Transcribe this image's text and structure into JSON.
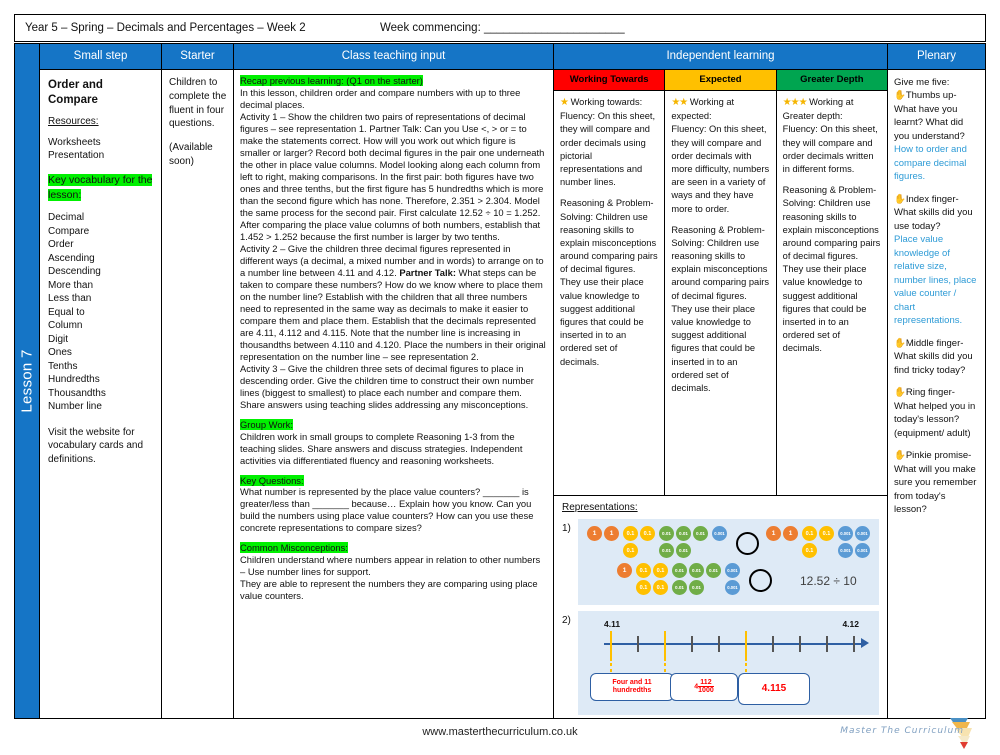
{
  "header": {
    "title": "Year 5 – Spring – Decimals and Percentages – Week 2",
    "week_commencing": "Week commencing: ______________________"
  },
  "spine": {
    "lesson_label": "Lesson 7"
  },
  "columns": {
    "small_step": "Small step",
    "starter": "Starter",
    "class_teaching_input": "Class teaching input",
    "independent_learning": "Independent learning",
    "plenary": "Plenary"
  },
  "small_step": {
    "title": "Order and Compare",
    "resources_heading": "Resources:",
    "resources": [
      "Worksheets",
      "Presentation"
    ],
    "key_vocab_heading": "Key vocabulary for the lesson:",
    "vocabulary": [
      "Decimal",
      "Compare",
      "Order",
      "Ascending",
      "Descending",
      "More than",
      "Less than",
      "Equal to",
      "Column",
      "Digit",
      "Ones",
      "Tenths",
      "Hundredths",
      "Thousandths",
      "Number line"
    ],
    "note": "Visit the website for vocabulary cards and definitions."
  },
  "starter": {
    "text": "Children to complete the fluent in four questions.",
    "availability": "(Available soon)"
  },
  "teaching": {
    "recap_heading": "Recap previous learning: (Q1 on the starter)",
    "intro": "In this lesson, children order and compare numbers with up to three decimal places.",
    "activity1": "Activity 1 – Show the children two pairs of representations of decimal figures – see representation 1. Partner Talk: Can you Use <, > or = to make the statements correct. How will you work out which figure is smaller or larger? Record both decimal figures in the pair one underneath the other in place value columns. Model looking along each column from left to right, making comparisons. In the first pair: both figures have two ones and three tenths, but the first figure has 5 hundredths which is more than the second figure which has none. Therefore, 2.351 > 2.304. Model the same process for the second pair. First calculate 12.52 ÷ 10 = 1.252. After comparing the place value columns of both numbers, establish that 1.452 > 1.252 because the first number is larger by two tenths.",
    "activity2_pre": "Activity 2 – Give the children three decimal figures represented in different ways (a decimal, a mixed number and in words) to arrange on to a number line between 4.11 and 4.12. ",
    "activity2_bold": "Partner Talk:",
    "activity2_post": " What steps can be taken to compare these numbers? How do we know where to place them on the number line? Establish with the children that all three numbers need to represented in the same way as decimals to make it easier to compare them and place them. Establish that the decimals represented are 4.11, 4.112 and 4.115. Note that the number line is increasing in thousandths between 4.110 and 4.120. Place the numbers in their original representation on the number line – see representation 2.",
    "activity3": "Activity 3 – Give the children three sets of decimal figures to place in descending order. Give the children time to construct their own number lines (biggest to smallest) to place each number and compare them.  Share answers using teaching slides addressing any misconceptions.",
    "group_work_heading": "Group Work:",
    "group_work": "Children work in small groups to complete Reasoning 1-3 from the teaching slides. Share answers and discuss strategies. Independent activities via differentiated fluency and reasoning worksheets.",
    "key_questions_heading": "Key Questions:",
    "key_questions": "What number is represented by the place value counters? _______ is greater/less than _______ because… Explain how you know. Can you build the numbers using place value counters? How can you use these concrete representations to compare sizes?",
    "misconceptions_heading": "Common Misconceptions:",
    "misconceptions_1": "Children understand where numbers appear in relation to other numbers – Use number lines for support.",
    "misconceptions_2": "They are able to represent the numbers they are comparing using place value counters."
  },
  "independent": {
    "bands": [
      {
        "label": "Working Towards",
        "color": "#ff0000",
        "stars": "★",
        "heading": "Working towards:",
        "fluency": "Fluency: On this sheet, they will compare and order decimals using pictorial representations and number lines.",
        "reasoning": "Reasoning & Problem-Solving: Children use reasoning skills to explain misconceptions around comparing pairs of decimal figures. They use their place value knowledge to suggest additional figures that could be inserted in to an ordered set of decimals."
      },
      {
        "label": "Expected",
        "color": "#ffc000",
        "stars": "★★",
        "heading": "Working at expected:",
        "fluency": "Fluency: On this sheet, they will compare and order decimals with more difficulty, numbers are seen in a variety of ways and they have more to order.",
        "reasoning": "Reasoning & Problem-Solving: Children use reasoning skills to explain misconceptions around comparing pairs of decimal figures. They use their place value knowledge to suggest additional figures that could be inserted in to an ordered set of decimals."
      },
      {
        "label": "Greater Depth",
        "color": "#00a550",
        "stars": "★★★",
        "heading": "Working at Greater depth:",
        "fluency": "Fluency: On this sheet, they will compare and order decimals written in different forms.",
        "reasoning": "Reasoning & Problem-Solving: Children use reasoning skills to explain misconceptions around comparing pairs of decimal figures. They use their place value knowledge to suggest additional figures that could be inserted in to an ordered set of decimals."
      }
    ],
    "representations_title": "Representations:",
    "rep1": {
      "number": "1)",
      "pair1_left": {
        "ones": 2,
        "tenths": 3,
        "hundredths": 5,
        "thousandths": 1
      },
      "pair1_right": {
        "ones": 2,
        "tenths": 3,
        "hundredths": 0,
        "thousandths": 4
      },
      "pair2_left": {
        "ones": 1,
        "tenths": 4,
        "hundredths": 5,
        "thousandths": 2
      },
      "expression": "12.52 ÷ 10",
      "coin_labels": {
        "one": "1",
        "tenth": "0.1",
        "hundredth": "0.01",
        "thousandth": "0.001"
      }
    },
    "rep2": {
      "number": "2)",
      "start_label": "4.11",
      "end_label": "4.12",
      "cards": [
        "Four and 11 hundredths",
        "4 112/1000",
        "4.115"
      ],
      "card_fraction": {
        "whole": "4",
        "numerator": "112",
        "denominator": "1000"
      },
      "ticks": 10,
      "marked_ticks": [
        0,
        2,
        5
      ]
    }
  },
  "plenary": {
    "intro": "Give me five:",
    "items": [
      {
        "finger": "Thumbs up-",
        "question": "What have you learnt? What did you understand?",
        "answer": "How to order and compare decimal figures."
      },
      {
        "finger": "Index finger-",
        "question": "What skills did you use today?",
        "answer": "Place value knowledge of relative size, number lines, place value counter / chart representations."
      },
      {
        "finger": "Middle finger-",
        "question": "What skills did you find tricky today?",
        "answer": ""
      },
      {
        "finger": "Ring finger-",
        "question": "What helped you in today's lesson? (equipment/ adult)",
        "answer": ""
      },
      {
        "finger": "Pinkie promise-",
        "question": "What will you make sure you remember from today's lesson?",
        "answer": ""
      }
    ]
  },
  "footer": {
    "website": "www.masterthecurriculum.co.uk",
    "logo_text": "Master The Curriculum"
  }
}
